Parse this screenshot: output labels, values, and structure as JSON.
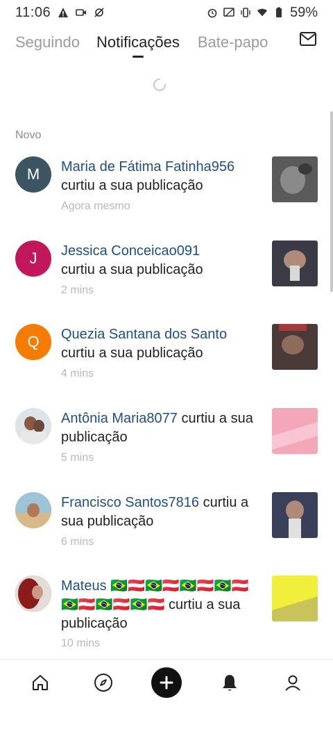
{
  "status_bar": {
    "time": "11:06",
    "battery": "59%"
  },
  "tabs": [
    {
      "label": "Seguindo"
    },
    {
      "label": "Notificações"
    },
    {
      "label": "Bate-papo"
    }
  ],
  "section_label": "Novo",
  "notifications": [
    {
      "avatar_letter": "M",
      "avatar_color": "#3d5562",
      "user": "Maria de Fátima Fatinha956",
      "action": "curtiu a sua publicação",
      "time": "Agora mesmo"
    },
    {
      "avatar_letter": "J",
      "avatar_color": "#c2185b",
      "user": "Jessica Conceicao091",
      "action": "curtiu a sua publicação",
      "time": "2 mins"
    },
    {
      "avatar_letter": "Q",
      "avatar_color": "#f57c00",
      "user": "Quezia Santana dos Santo",
      "action": "curtiu a sua publicação",
      "time": "4 mins"
    },
    {
      "avatar_letter": "",
      "user": "Antônia Maria8077",
      "action": " curtiu a sua publicação",
      "time": "5 mins"
    },
    {
      "avatar_letter": "",
      "user": "Francisco Santos7816",
      "action": " curtiu a sua publicação",
      "time": "6 mins"
    },
    {
      "avatar_letter": "",
      "user": "Mateus 🇧🇷🇦🇹🇧🇷🇦🇹🇧🇷🇦🇹🇧🇷🇦🇹🇧🇷🇦🇹🇧🇷🇦🇹🇧🇷🇦🇹",
      "action": " curtiu a sua publicação",
      "time": "10 mins"
    }
  ],
  "bottom_nav": [
    "home-icon",
    "explore-icon",
    "add-icon",
    "notifications-icon",
    "profile-icon"
  ],
  "colors": {
    "name": "#1e4f87",
    "inactive_tab": "#9b9b9b",
    "time": "#b8b8b8"
  }
}
